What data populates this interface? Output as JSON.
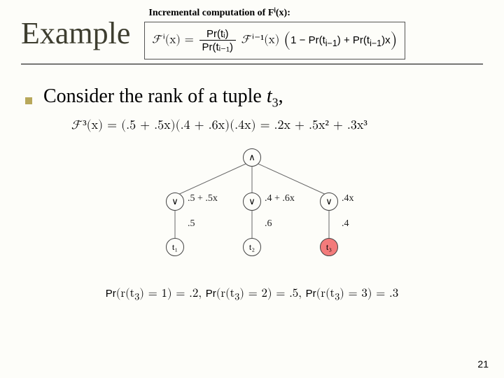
{
  "title": "Example",
  "incremental": {
    "heading": "Incremental computation of Fⁱ(x):",
    "lhs": "ℱⁱ(x) =",
    "frac_num": "Pr(tᵢ)",
    "frac_den": "Pr(tᵢ₋₁)",
    "mid": "ℱⁱ⁻¹(x)",
    "paren": "(1 − Pr(tᵢ₋₁) + Pr(tᵢ₋₁)x)"
  },
  "bullet": {
    "text_before": "Consider the rank of a tuple ",
    "t": "t",
    "sub": "3",
    "after": ","
  },
  "expansion": "ℱ³(x) = (.5 + .5x)(.4 + .6x)(.4x) = .2x + .5x² + .3x³",
  "tree": {
    "root": "∧",
    "or": "∨",
    "e1_outer": ".5 + .5x",
    "e2_outer": ".4 + .6x",
    "e3_outer": ".4x",
    "e1_inner": ".5",
    "e2_inner": ".6",
    "e3_inner": ".4",
    "t1": "t₁",
    "t2": "t₂",
    "t3": "t₃"
  },
  "prob_line": "Pr(r(t₃) = 1) = .2, Pr(r(t₃) = 2) = .5, Pr(r(t₃) = 3) = .3",
  "slide_num": "21"
}
